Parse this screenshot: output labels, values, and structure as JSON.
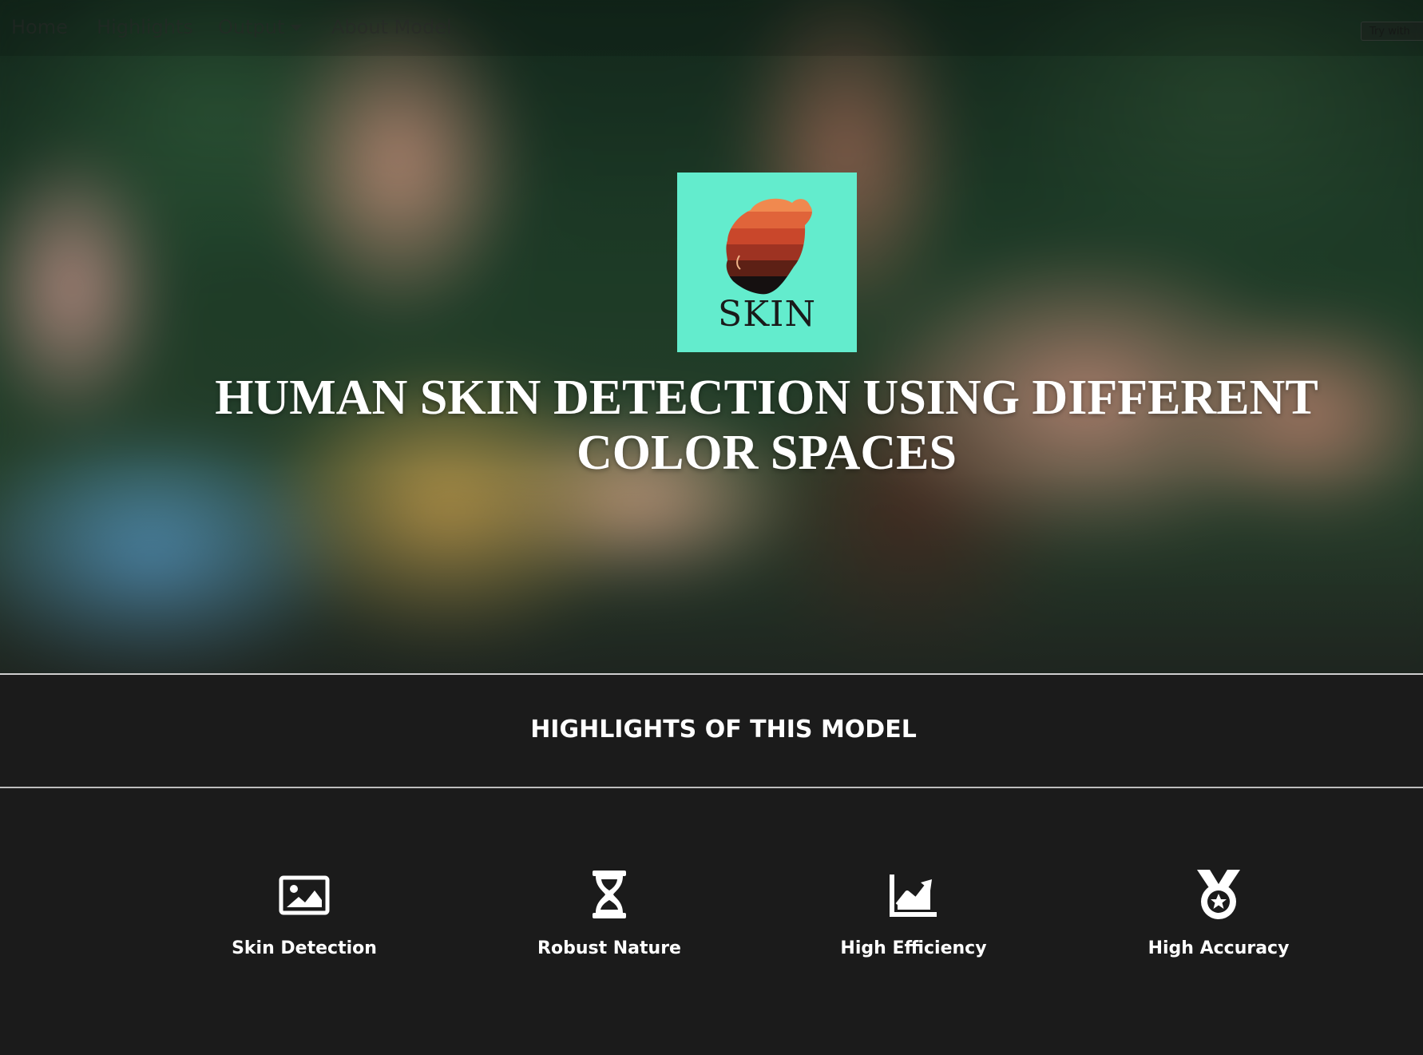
{
  "nav": {
    "items": [
      {
        "label": "Home"
      },
      {
        "label": "Highlights"
      },
      {
        "label": "Output"
      },
      {
        "label": "About Model"
      }
    ],
    "try_button_label": "Try with"
  },
  "hero": {
    "logo_text": "SKIN",
    "title": "HUMAN SKIN DETECTION USING DIFFERENT COLOR SPACES"
  },
  "highlights": {
    "heading": "HIGHLIGHTS OF THIS MODEL",
    "features": [
      {
        "label": "Skin Detection",
        "icon": "image-icon"
      },
      {
        "label": "Robust Nature",
        "icon": "hourglass-icon"
      },
      {
        "label": "High Efficiency",
        "icon": "chart-line-icon"
      },
      {
        "label": "High Accuracy",
        "icon": "medal-icon"
      }
    ]
  },
  "colors": {
    "logo_background": "#63eccd",
    "page_background": "#1b1b1b",
    "text": "#ffffff"
  }
}
